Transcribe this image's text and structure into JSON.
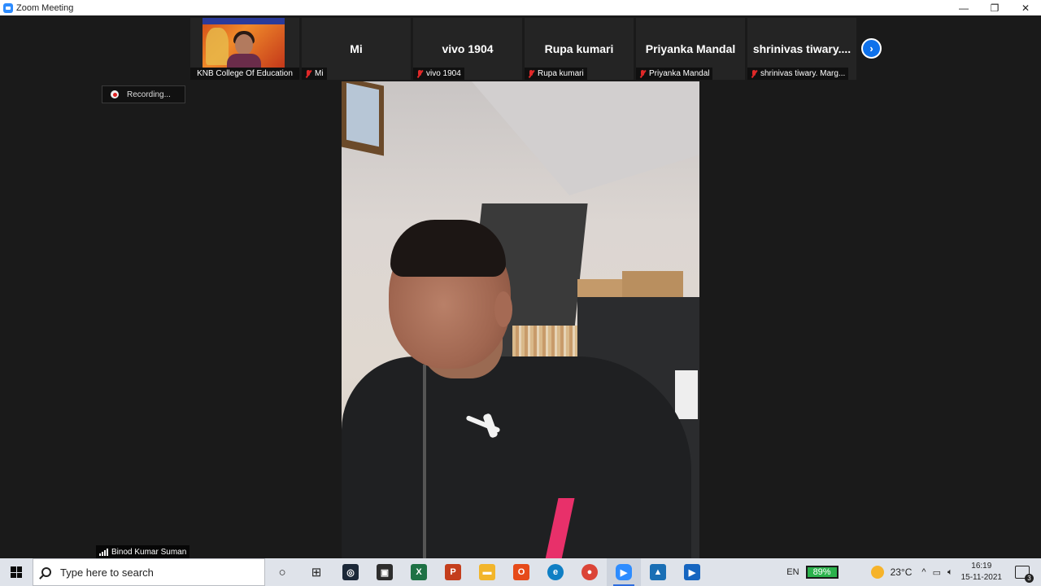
{
  "window": {
    "title": "Zoom Meeting",
    "minimize": "—",
    "restore": "❐",
    "close": "✕"
  },
  "participants": [
    {
      "id": "knb",
      "label": "KNB College Of Education",
      "has_video": true,
      "muted": false
    },
    {
      "id": "mi",
      "display": "Mi",
      "label": "Mi",
      "muted": true
    },
    {
      "id": "vivo",
      "display": "vivo 1904",
      "label": "vivo 1904",
      "muted": true
    },
    {
      "id": "rupa",
      "display": "Rupa kumari",
      "label": "Rupa kumari",
      "muted": true
    },
    {
      "id": "priyanka",
      "display": "Priyanka Mandal",
      "label": "Priyanka Mandal",
      "muted": true
    },
    {
      "id": "shrinivas",
      "display": "shrinivas  tiwary....",
      "label": "shrinivas tiwary. Marg...",
      "muted": true
    }
  ],
  "next_page_icon": "chevron-right-icon",
  "recording": {
    "text": "Recording..."
  },
  "active_speaker": {
    "name": "Binod Kumar Suman"
  },
  "taskbar": {
    "search_placeholder": "Type here to search",
    "cortana_glyph": "○",
    "taskview_glyph": "⊞",
    "apps": [
      {
        "name": "steam",
        "glyph": "◎",
        "color": "#1b2838"
      },
      {
        "name": "store",
        "glyph": "▣",
        "color": "#2d2d2d"
      },
      {
        "name": "excel",
        "glyph": "X",
        "color": "#1e7145"
      },
      {
        "name": "powerpoint-viewer",
        "glyph": "P",
        "color": "#c43e1c"
      },
      {
        "name": "file-explorer",
        "glyph": "▬",
        "color": "#f2b52b"
      },
      {
        "name": "office",
        "glyph": "O",
        "color": "#e64a19"
      },
      {
        "name": "edge",
        "glyph": "e",
        "color": "#0f7fc4"
      },
      {
        "name": "chrome",
        "glyph": "●",
        "color": "#db4437"
      },
      {
        "name": "zoom",
        "glyph": "▶",
        "color": "#2d8cff"
      },
      {
        "name": "photos",
        "glyph": "▲",
        "color": "#1a6fb5"
      },
      {
        "name": "media-player",
        "glyph": "▶",
        "color": "#1565c0"
      }
    ],
    "language": "EN",
    "battery_percent": "89%",
    "temperature": "23°C",
    "time": "16:19",
    "date": "15-11-2021",
    "notification_count": "3"
  },
  "colors": {
    "accent": "#0e71eb",
    "muted_mic": "#e02828",
    "battery": "#2bb24c"
  }
}
